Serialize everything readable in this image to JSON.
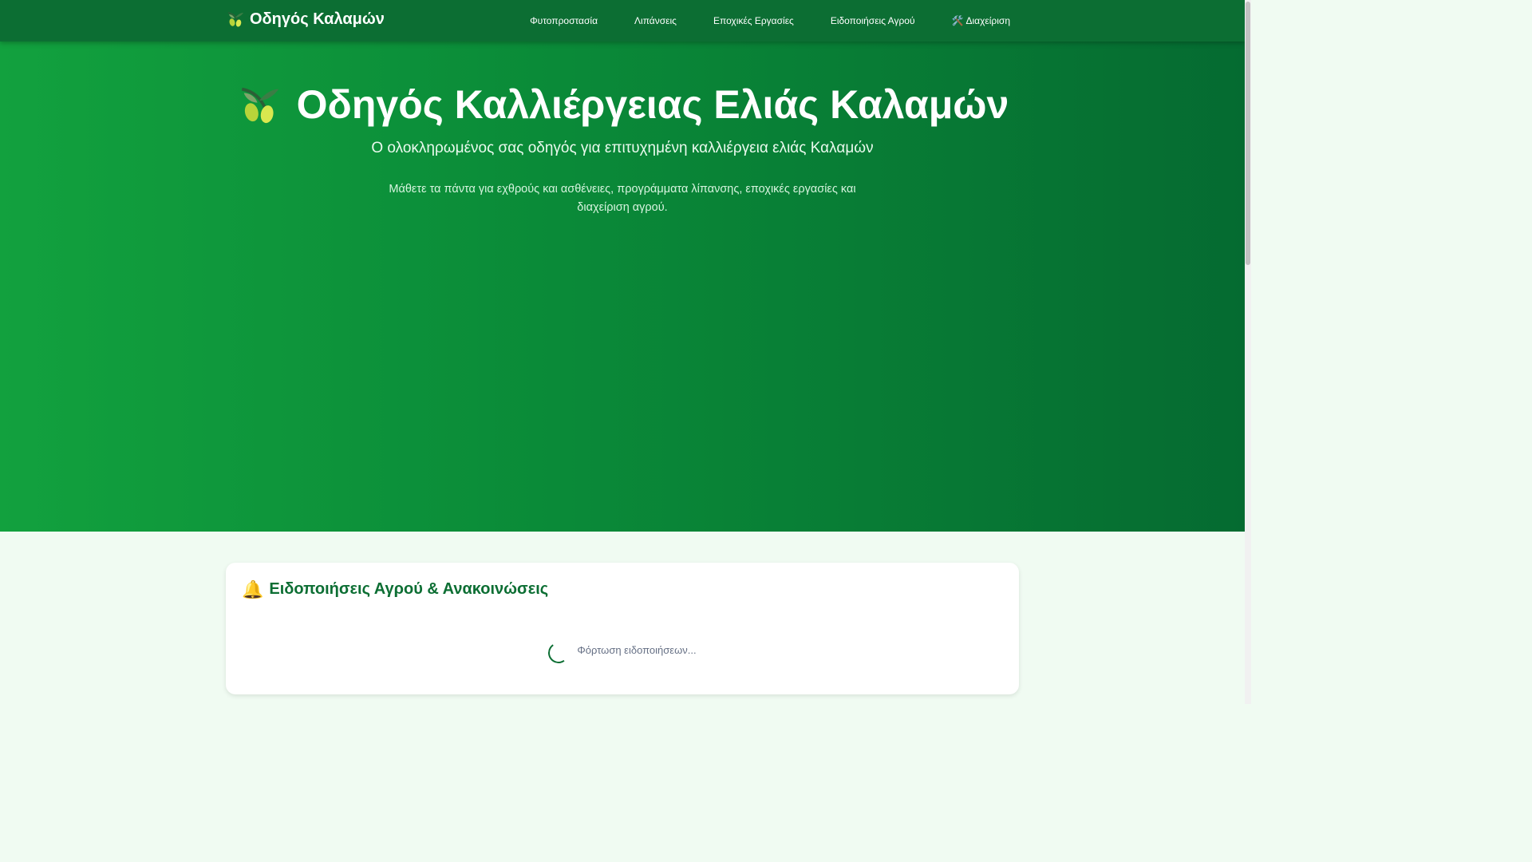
{
  "navbar": {
    "brand": "Οδηγός Καλαμών",
    "items": [
      {
        "label": "Φυτοπροστασία"
      },
      {
        "label": "Λιπάνσεις"
      },
      {
        "label": "Εποχικές Εργασίες"
      },
      {
        "label": "Ειδοποιήσεις Αγρού"
      },
      {
        "label": "Διαχείριση",
        "icon": "tools-icon"
      }
    ]
  },
  "hero": {
    "title": "Οδηγός Καλλιέργειας Ελιάς Καλαμών",
    "subtitle": "Ο ολοκληρωμένος σας οδηγός για επιτυχημένη καλλιέργεια ελιάς Καλαμών",
    "description": "Μάθετε τα πάντα για εχθρούς και ασθένειες, προγράμματα λίπανσης, εποχικές εργασίες και διαχείριση αγρού."
  },
  "alerts": {
    "icon": "bell-icon",
    "title": "Ειδοποιήσεις Αγρού & Ανακοινώσεις",
    "loading_text": "Φόρτωση ειδοποιήσεων..."
  },
  "colors": {
    "navbar": "#0c6e33",
    "hero_start": "#12a13e",
    "hero_end": "#056b31",
    "accent": "#0c6e33",
    "page_bg": "#f0fbf2"
  }
}
